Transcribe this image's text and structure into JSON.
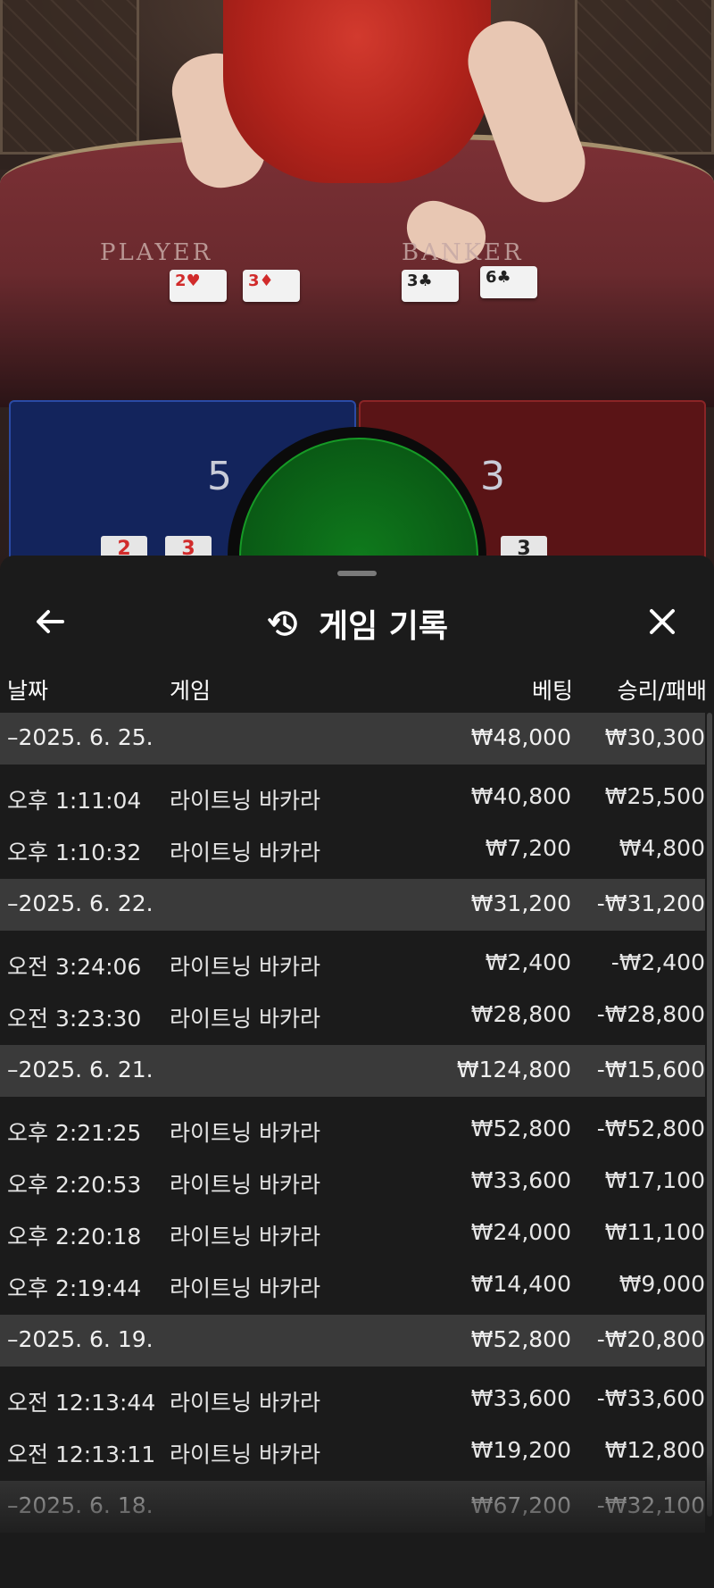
{
  "game_table": {
    "player_label": "PLAYER",
    "banker_label": "BANKER",
    "player_cards": [
      "2♥",
      "3♦"
    ],
    "banker_cards": [
      "3♣",
      "6♣"
    ],
    "player_score": "5",
    "banker_score": "3",
    "player_mini_cards": [
      "2",
      "3"
    ],
    "banker_mini_cards": [
      "3"
    ]
  },
  "sheet": {
    "title": "게임 기록",
    "columns": {
      "date": "날짜",
      "game": "게임",
      "bet": "베팅",
      "result": "승리/패배"
    }
  },
  "groups": [
    {
      "date": "–2025. 6. 25.",
      "bet": "₩48,000",
      "result": "₩30,300",
      "items": [
        {
          "time": "오후 1:11:04",
          "game": "라이트닝 바카라",
          "bet": "₩40,800",
          "result": "₩25,500"
        },
        {
          "time": "오후 1:10:32",
          "game": "라이트닝 바카라",
          "bet": "₩7,200",
          "result": "₩4,800"
        }
      ]
    },
    {
      "date": "–2025. 6. 22.",
      "bet": "₩31,200",
      "result": "-₩31,200",
      "items": [
        {
          "time": "오전 3:24:06",
          "game": "라이트닝 바카라",
          "bet": "₩2,400",
          "result": "-₩2,400"
        },
        {
          "time": "오전 3:23:30",
          "game": "라이트닝 바카라",
          "bet": "₩28,800",
          "result": "-₩28,800"
        }
      ]
    },
    {
      "date": "–2025. 6. 21.",
      "bet": "₩124,800",
      "result": "-₩15,600",
      "items": [
        {
          "time": "오후 2:21:25",
          "game": "라이트닝 바카라",
          "bet": "₩52,800",
          "result": "-₩52,800"
        },
        {
          "time": "오후 2:20:53",
          "game": "라이트닝 바카라",
          "bet": "₩33,600",
          "result": "₩17,100"
        },
        {
          "time": "오후 2:20:18",
          "game": "라이트닝 바카라",
          "bet": "₩24,000",
          "result": "₩11,100"
        },
        {
          "time": "오후 2:19:44",
          "game": "라이트닝 바카라",
          "bet": "₩14,400",
          "result": "₩9,000"
        }
      ]
    },
    {
      "date": "–2025. 6. 19.",
      "bet": "₩52,800",
      "result": "-₩20,800",
      "items": [
        {
          "time": "오전 12:13:44",
          "game": "라이트닝 바카라",
          "bet": "₩33,600",
          "result": "-₩33,600"
        },
        {
          "time": "오전 12:13:11",
          "game": "라이트닝 바카라",
          "bet": "₩19,200",
          "result": "₩12,800"
        }
      ]
    },
    {
      "date": "–2025. 6. 18.",
      "bet": "₩67,200",
      "result": "-₩32,100",
      "items": []
    }
  ],
  "icons": {
    "back": "arrow-left-icon",
    "history": "history-icon",
    "close": "close-icon"
  }
}
